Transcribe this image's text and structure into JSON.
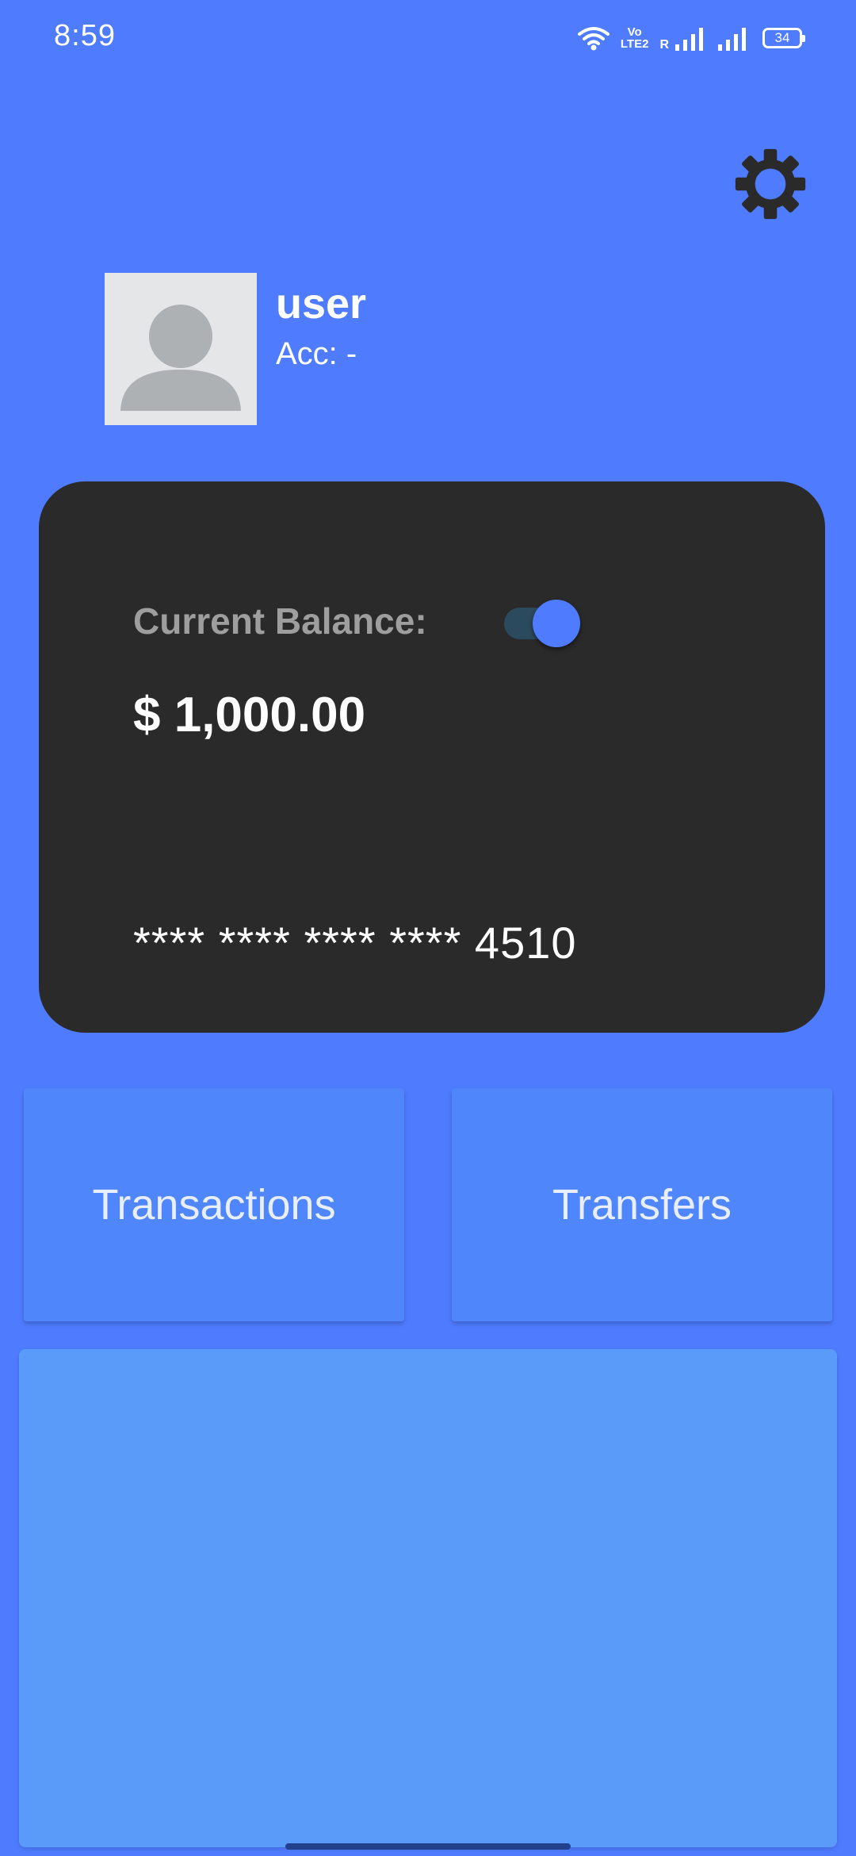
{
  "status_bar": {
    "time": "8:59",
    "volte_top": "Vo",
    "volte_bottom": "LTE2",
    "roaming": "R",
    "battery": "34"
  },
  "header": {
    "settings_icon": "gear-icon"
  },
  "profile": {
    "name": "user",
    "account": "Acc: -",
    "avatar_icon": "default-avatar-icon"
  },
  "card": {
    "balance_label": "Current Balance:",
    "balance_toggle_on": true,
    "balance_amount": "$ 1,000.00",
    "card_number": "**** **** **** **** 4510"
  },
  "actions": {
    "transactions_label": "Transactions",
    "transfers_label": "Transfers"
  },
  "colors": {
    "background": "#4f7cff",
    "card": "#2a2a2a",
    "button": "#4f86fb",
    "panel": "#5a9af9",
    "toggle_thumb": "#4f7cff"
  }
}
